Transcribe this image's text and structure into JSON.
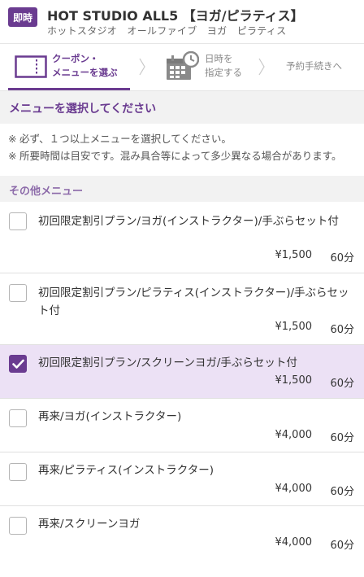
{
  "header": {
    "badge": "即時",
    "shop_name": "HOT STUDIO ALL5 【ヨガ/ピラティス】",
    "shop_kana": "ホットスタジオ　オールファイブ　ヨガ　ピラティス"
  },
  "steps": {
    "step1_line1": "クーポン・",
    "step1_line2": "メニューを選ぶ",
    "step2_line1": "日時を",
    "step2_line2": "指定する",
    "step3": "予約手続きへ"
  },
  "section_title": "メニューを選択してください",
  "notes": [
    {
      "mark": "※",
      "text": "必ず、１つ以上メニューを選択してください。"
    },
    {
      "mark": "※",
      "text": "所要時間は目安です。混み具合等によって多少異なる場合があります。"
    }
  ],
  "subsection_title": "その他メニュー",
  "menu_items": [
    {
      "name": "初回限定割引プラン/ヨガ(インストラクター)/手ぶらセット付",
      "price": "¥1,500",
      "duration": "60分",
      "checked": false
    },
    {
      "name": "初回限定割引プラン/ピラティス(インストラクター)/手ぶらセット付",
      "price": "¥1,500",
      "duration": "60分",
      "checked": false
    },
    {
      "name": "初回限定割引プラン/スクリーンヨガ/手ぶらセット付",
      "price": "¥1,500",
      "duration": "60分",
      "checked": true
    },
    {
      "name": "再来/ヨガ(インストラクター)",
      "price": "¥4,000",
      "duration": "60分",
      "checked": false
    },
    {
      "name": "再来/ピラティス(インストラクター)",
      "price": "¥4,000",
      "duration": "60分",
      "checked": false
    },
    {
      "name": "再来/スクリーンヨガ",
      "price": "¥4,000",
      "duration": "60分",
      "checked": false
    }
  ],
  "colors": {
    "accent": "#6a3b90",
    "selected_bg": "#ece1f5",
    "section_bg": "#f2f2f2"
  },
  "icons": {
    "step1": "coupon-ticket-icon",
    "step2": "calendar-clock-icon",
    "step_separator": "chevron-right-icon",
    "checkbox_checked": "checkmark-icon"
  }
}
